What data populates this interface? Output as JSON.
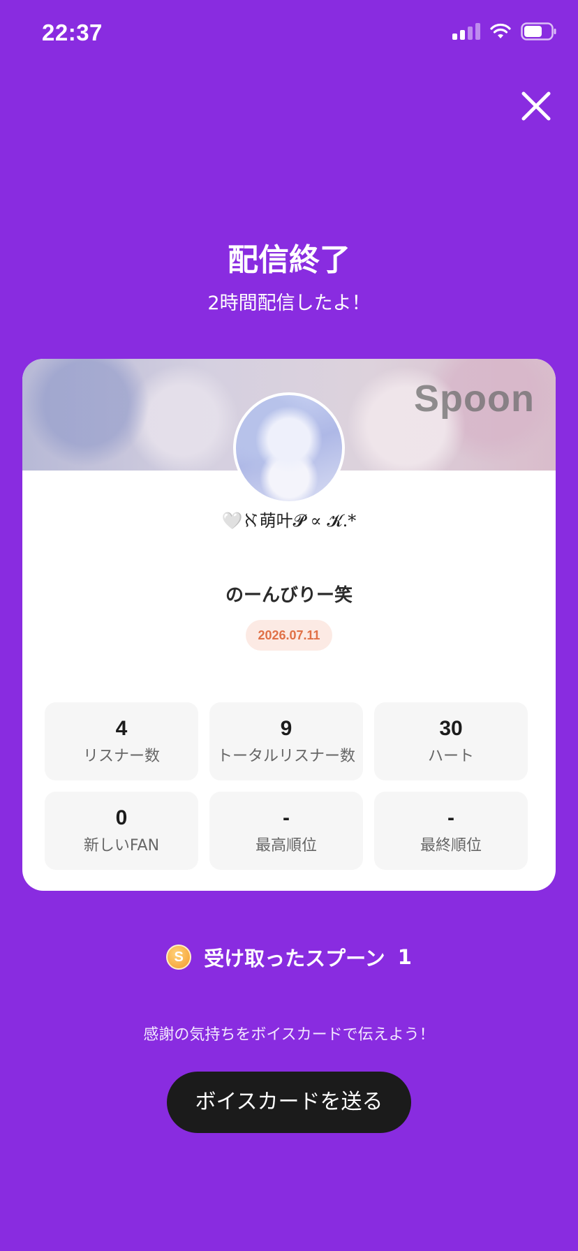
{
  "status_bar": {
    "time": "22:37"
  },
  "header": {
    "title": "配信終了",
    "subtitle": "2時間配信したよ！"
  },
  "card": {
    "banner_logo": "Spoon",
    "username": "🤍ℵ萌叶𝓟 ∝ 𝓚.*",
    "stream_title": "のーんびりー笑",
    "date": "2026.07.11",
    "stats": [
      {
        "value": "4",
        "label": "リスナー数"
      },
      {
        "value": "9",
        "label": "トータルリスナー数"
      },
      {
        "value": "30",
        "label": "ハート"
      },
      {
        "value": "0",
        "label": "新しいFAN"
      },
      {
        "value": "-",
        "label": "最高順位"
      },
      {
        "value": "-",
        "label": "最終順位"
      }
    ]
  },
  "spoons": {
    "coin_symbol": "S",
    "label": "受け取ったスプーン",
    "count": "1"
  },
  "footer": {
    "thanks_text": "感謝の気持ちをボイスカードで伝えよう！",
    "voice_card_button": "ボイスカードを送る"
  },
  "colors": {
    "background": "#892CE0",
    "button": "#1B1B1B",
    "date_badge_text": "#E07046"
  }
}
